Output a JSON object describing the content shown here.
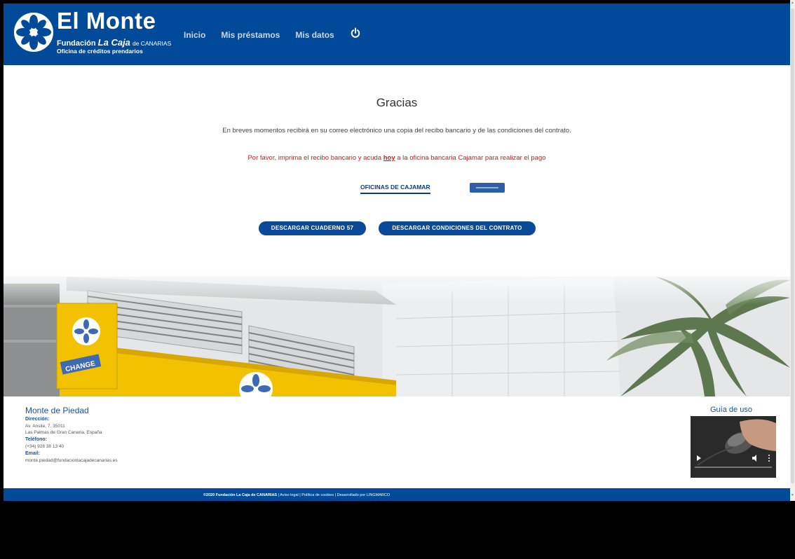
{
  "header": {
    "logo_name": "El Monte",
    "logo_fundacion": "Fundación",
    "logo_caja": "La Caja",
    "logo_de": "de CANARIAS",
    "logo_oficina": "Oficina de créditos prendarios",
    "nav": [
      "Inicio",
      "Mis préstamos",
      "Mis datos"
    ],
    "power_icon": "power-icon"
  },
  "content": {
    "title": "Gracias",
    "message": "En breves momentos recibirá en su correo electrónico una copia del recibo bancario y de las condiciones del contrato.",
    "warning_pre": "Por favor, imprima el recibo bancario y acuda ",
    "warning_hoy": "hoy",
    "warning_post": " a la oficina bancaria Cajamar para realizar el pago",
    "offices_link": "OFICINAS DE CAJAMAR",
    "btn_cuaderno": "DESCARGAR CUADERNO 57",
    "btn_condiciones": "DESCARGAR CONDICIONES DEL CONTRATO"
  },
  "hero": {
    "sign_text": "CHANGE"
  },
  "footer": {
    "title": "Monte de Piedad",
    "direccion_label": "Dirección:",
    "direccion_line1": "Av. Ansite, 7, 35011",
    "direccion_line2": "Las Palmas de Gran Canaria, España",
    "telefono_label": "Teléfono:",
    "telefono": "(+34) 928 38 13 40",
    "email_label": "Email:",
    "email": "monte.piedad@fundacionlacajadecanarias.es",
    "guide_title": "Guía de uso",
    "copyright_bold": "©2020 Fundación La Caja de CANARIAS",
    "copyright_rest": " | Aviso legal | Política de cookies | Desarrollado por LINGMARCO"
  },
  "colors": {
    "brand_blue": "#004a99",
    "warning_red": "#d11a1a",
    "accent_yellow": "#f2c200"
  }
}
